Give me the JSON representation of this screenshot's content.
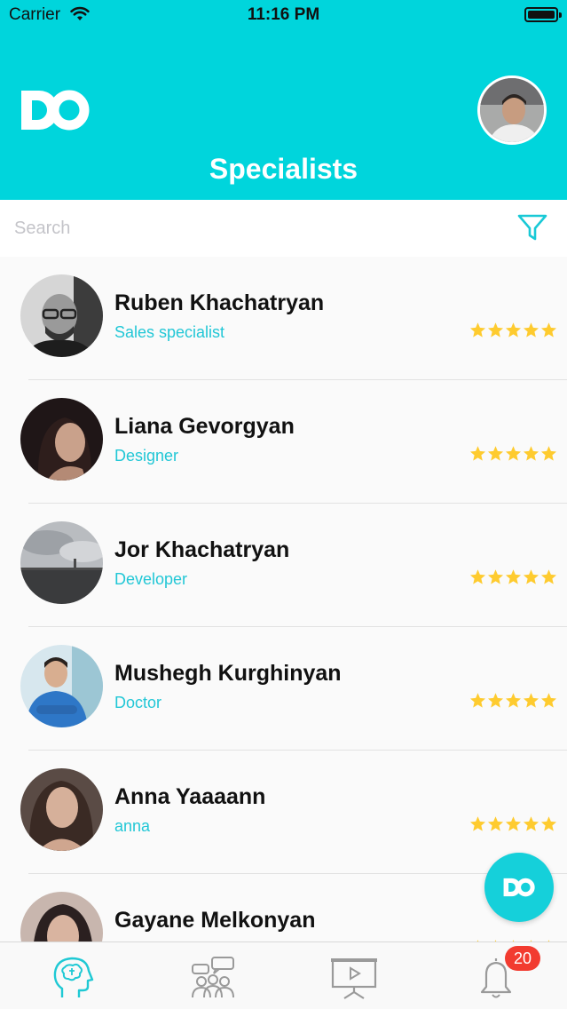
{
  "status_bar": {
    "carrier": "Carrier",
    "time": "11:16 PM"
  },
  "header": {
    "title": "Specialists",
    "logo": "DO"
  },
  "search": {
    "placeholder": "Search",
    "value": ""
  },
  "colors": {
    "accent": "#00d5dc",
    "role_text": "#22c7d6",
    "star": "#fecb2f",
    "badge": "#f23b30"
  },
  "specialists": [
    {
      "name": "Ruben Khachatryan",
      "role": "Sales specialist",
      "rating": 5
    },
    {
      "name": "Liana Gevorgyan",
      "role": "Designer",
      "rating": 5
    },
    {
      "name": "Jor Khachatryan",
      "role": "Developer",
      "rating": 5
    },
    {
      "name": "Mushegh Kurghinyan",
      "role": "Doctor",
      "rating": 5
    },
    {
      "name": "Anna Yaaaann",
      "role": "anna",
      "rating": 5
    },
    {
      "name": "Gayane Melkonyan",
      "role": "",
      "rating": 5
    }
  ],
  "tabbar": {
    "tabs": [
      {
        "icon": "head-brain-icon",
        "active": true
      },
      {
        "icon": "group-chat-icon",
        "active": false
      },
      {
        "icon": "presentation-board-icon",
        "active": false
      },
      {
        "icon": "bell-icon",
        "active": false
      }
    ],
    "notifications_badge": "20"
  }
}
